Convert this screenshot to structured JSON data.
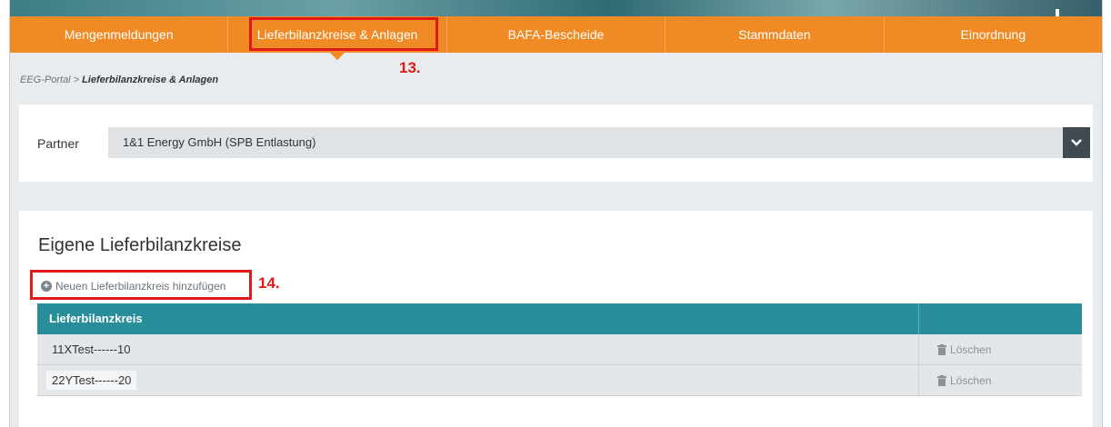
{
  "nav": {
    "items": [
      {
        "label": "Mengenmeldungen"
      },
      {
        "label": "Lieferbilanzkreise & Anlagen"
      },
      {
        "label": "BAFA-Bescheide"
      },
      {
        "label": "Stammdaten"
      },
      {
        "label": "Einordnung"
      }
    ]
  },
  "annotations": {
    "step13": "13.",
    "step14": "14.",
    "color": "#e01919"
  },
  "breadcrumb": {
    "root": "EEG-Portal",
    "separator": ">",
    "current": "Lieferbilanzkreise & Anlagen"
  },
  "partner": {
    "label": "Partner",
    "selected": "1&1 Energy GmbH (SPB Entlastung)",
    "toggle_icon": "chevron-down-icon"
  },
  "section": {
    "title": "Eigene Lieferbilanzkreise",
    "add_label": "Neuen Lieferbilanzkreis hinzufügen",
    "add_icon": "plus-circle-icon"
  },
  "table": {
    "header": "Lieferbilanzkreis",
    "rows": [
      {
        "name": "11XTest------10",
        "action": "Löschen"
      },
      {
        "name": "22YTest------20",
        "action": "Löschen"
      }
    ]
  },
  "colors": {
    "nav": "#f08a24",
    "table_header": "#2a8e9a",
    "select_button": "#3f4a52"
  }
}
